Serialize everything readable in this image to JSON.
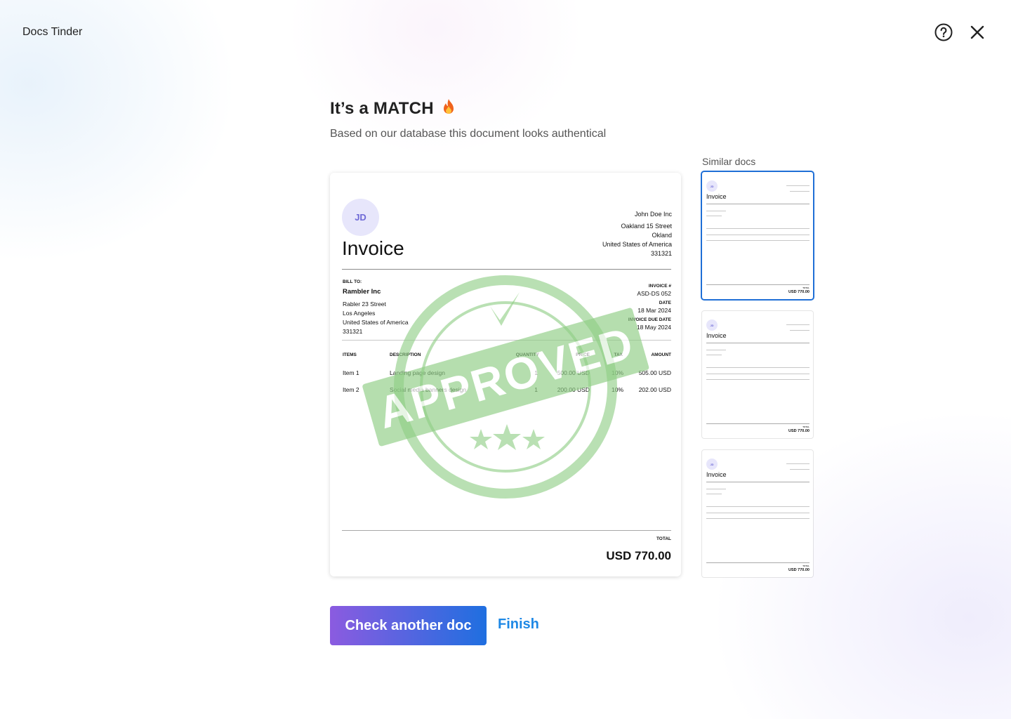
{
  "app": {
    "title": "Docs Tinder"
  },
  "header": {
    "help_icon": "help-circle-icon",
    "close_icon": "close-icon"
  },
  "result": {
    "title": "It’s a MATCH",
    "title_emoji": "fire-icon",
    "subtitle": "Based on our database this document looks authentical"
  },
  "document": {
    "avatar": "JD",
    "title": "Invoice",
    "from": [
      "John Doe Inc",
      "Oakland 15 Street",
      "Okland",
      "United States of America",
      "331321"
    ],
    "bill_to_label": "BILL TO:",
    "bill_to_name": "Rambler Inc",
    "bill_to_lines": [
      "Rabler 23 Street",
      "Los Angeles",
      "United States of America",
      "331321"
    ],
    "invoice_no_label": "INVOICE #",
    "invoice_no": "ASD-DS 052",
    "date_label": "DATE",
    "date": "18 Mar 2024",
    "due_label": "INVOICE DUE DATE",
    "due": "18 May 2024",
    "columns": [
      "ITEMS",
      "DESCRIPTION",
      "QUANTITY",
      "PRICE",
      "TAX",
      "AMOUNT"
    ],
    "rows": [
      [
        "Item 1",
        "Landing page design",
        "1",
        "500.00 USD",
        "10%",
        "505.00 USD"
      ],
      [
        "Item 2",
        "Social media banners design",
        "1",
        "200.00 USD",
        "10%",
        "202.00 USD"
      ]
    ],
    "total_label": "TOTAL",
    "total": "USD 770.00",
    "stamp": {
      "text": "APPROVED",
      "color": "#8fce85"
    }
  },
  "similar": {
    "label": "Similar docs",
    "items": [
      {
        "avatar": "JD",
        "title": "Invoice",
        "total_label": "TOTAL",
        "total": "USD 770.00",
        "selected": true
      },
      {
        "avatar": "JD",
        "title": "Invoice",
        "total_label": "TOTAL",
        "total": "USD 770.00",
        "selected": false
      },
      {
        "avatar": "JD",
        "title": "Invoice",
        "total_label": "TOTAL",
        "total": "USD 770.00",
        "selected": false
      }
    ]
  },
  "actions": {
    "primary": "Check another doc",
    "secondary": "Finish"
  },
  "colors": {
    "accent": "#1e88e5",
    "gradient_start": "#8b5be0",
    "gradient_end": "#1f6fe0",
    "selected_border": "#1f6fd6"
  }
}
